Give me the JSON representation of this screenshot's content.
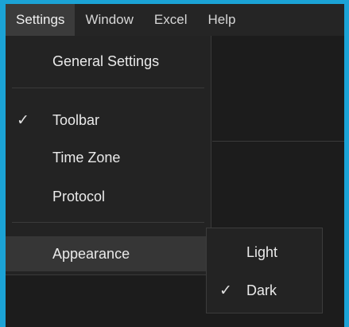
{
  "menubar": {
    "items": [
      {
        "label": "Settings",
        "active": true
      },
      {
        "label": "Window",
        "active": false
      },
      {
        "label": "Excel",
        "active": false
      },
      {
        "label": "Help",
        "active": false
      }
    ]
  },
  "settings_menu": {
    "general_settings": "General Settings",
    "toolbar": "Toolbar",
    "toolbar_checked": true,
    "time_zone": "Time Zone",
    "protocol": "Protocol",
    "appearance": "Appearance",
    "check_glyph": "✓",
    "submenu_arrow_glyph": "›"
  },
  "appearance_submenu": {
    "light": "Light",
    "dark": "Dark",
    "dark_checked": true,
    "check_glyph": "✓"
  },
  "colors": {
    "frame": "#1ba3d6",
    "menu_bg": "#232323",
    "highlight": "#363636"
  }
}
